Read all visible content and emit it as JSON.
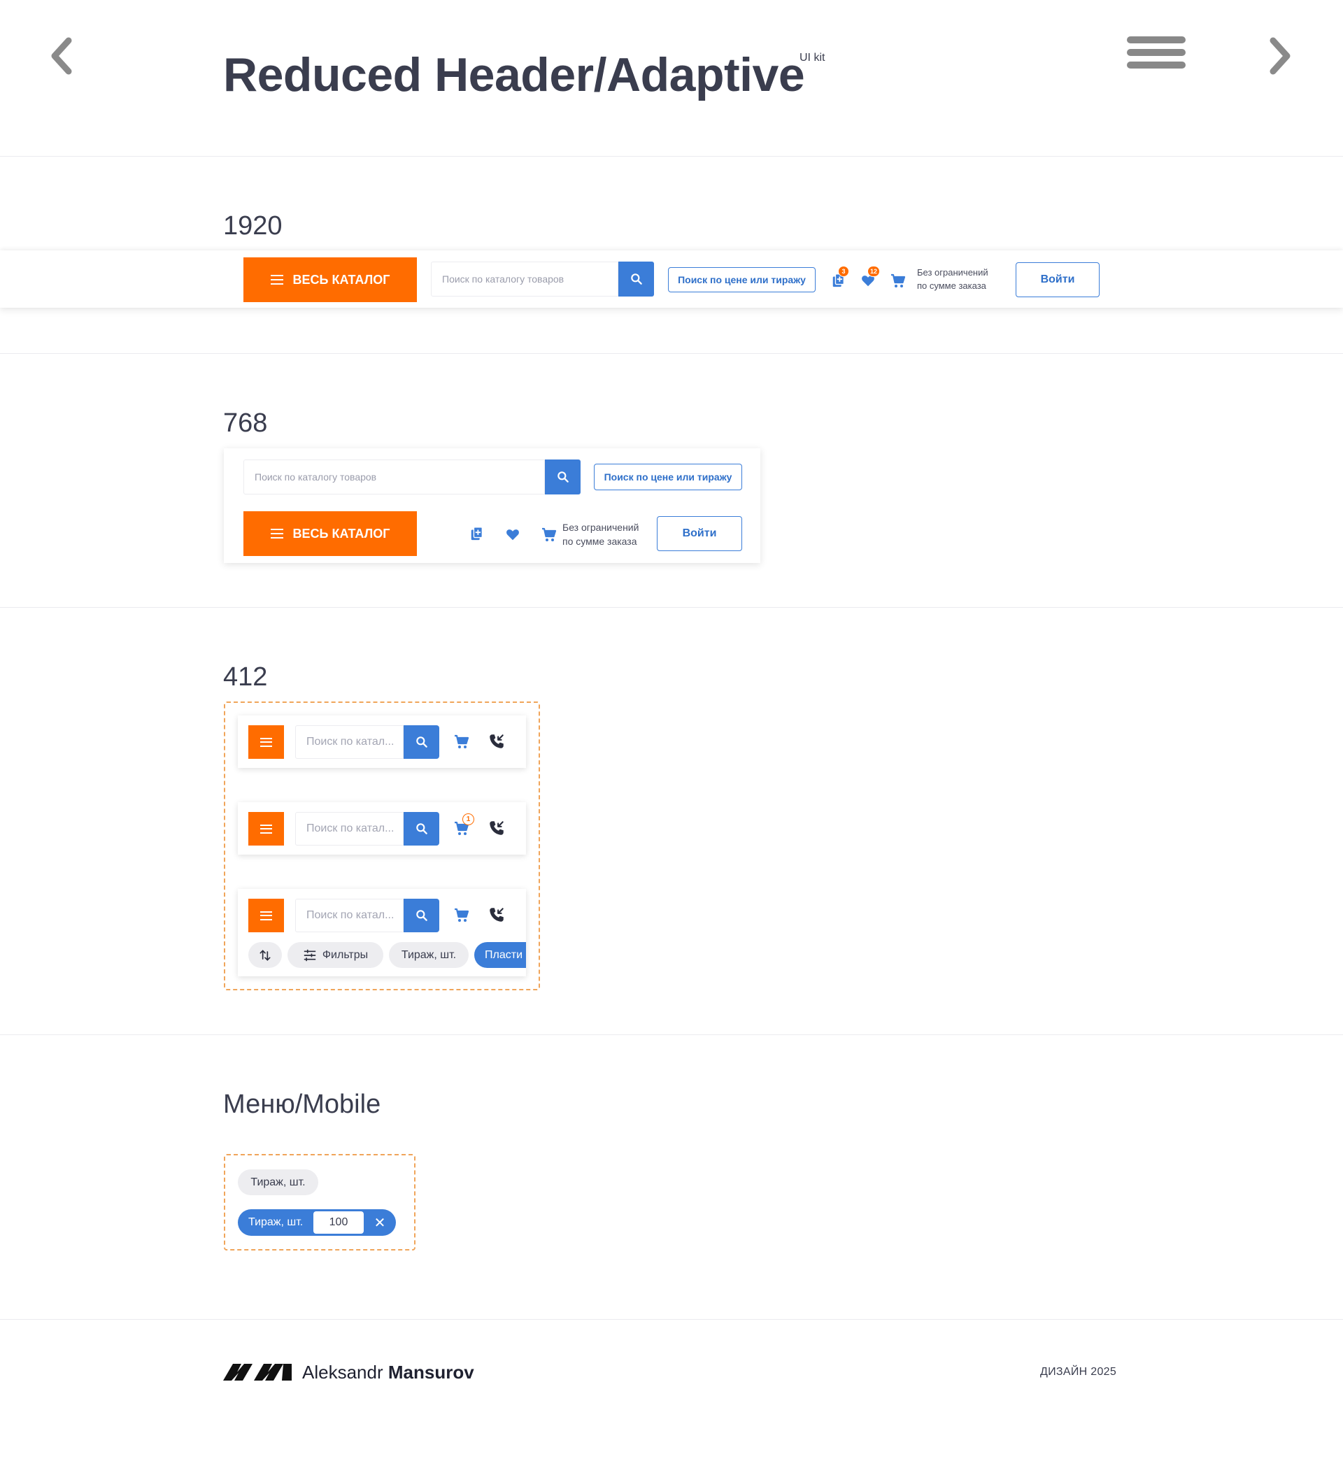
{
  "header": {
    "title": "Reduced Header/Adaptive",
    "subtitle": "UI kit"
  },
  "sections": {
    "s1920": "1920",
    "s768": "768",
    "s412": "412",
    "menu_mobile": "Меню/Mobile"
  },
  "site_header": {
    "catalog_label": "ВЕСЬ КАТАЛОГ",
    "search_placeholder": "Поиск по каталогу товаров",
    "price_search_label": "Поиск по цене или тиражу",
    "compare_badge": "3",
    "favorites_badge": "12",
    "limit_line1": "Без ограничений",
    "limit_line2": "по сумме заказа",
    "login_label": "Войти"
  },
  "mobile": {
    "search_placeholder": "Поиск по катал...",
    "cart_badge": "1",
    "chips": {
      "filters": "Фильтры",
      "quantity": "Тираж, шт.",
      "plastic": "Пласти"
    }
  },
  "menu_mobile": {
    "chip_label": "Тираж, шт.",
    "active_label": "Тираж, шт.",
    "qty_value": "100",
    "clear_label": "✕"
  },
  "footer": {
    "first_name": "Aleksandr",
    "last_name": "Mansurov",
    "right_text": "ДИЗАЙН 2025"
  },
  "colors": {
    "accent_orange": "#ff6c00",
    "accent_blue": "#3b7dd8",
    "text_dark": "#3a3d4e"
  },
  "icons": [
    "chevron-left-icon",
    "chevron-right-icon",
    "hamburger-icon",
    "search-icon",
    "compare-icon",
    "heart-icon",
    "cart-icon",
    "phone-icon",
    "sort-icon",
    "filter-icon",
    "close-icon"
  ]
}
